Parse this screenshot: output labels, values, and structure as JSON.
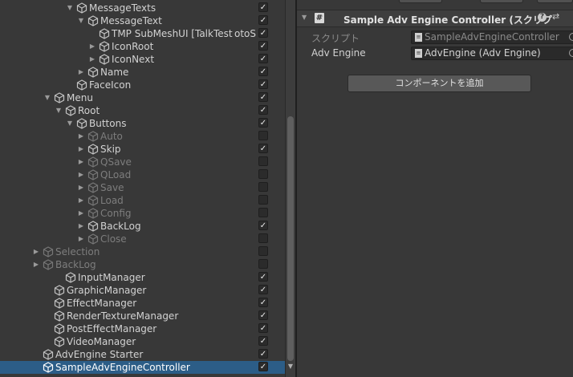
{
  "hierarchy": {
    "rows": [
      {
        "label": "MessageTexts",
        "arrow": "down",
        "checked": true
      },
      {
        "label": "MessageText",
        "arrow": "down",
        "checked": true
      },
      {
        "label": "TMP SubMeshUI [TalkTest otoS",
        "arrow": "",
        "checked": true
      },
      {
        "label": "IconRoot",
        "arrow": "right",
        "checked": true
      },
      {
        "label": "IconNext",
        "arrow": "right",
        "checked": true
      },
      {
        "label": "Name",
        "arrow": "right",
        "checked": true
      },
      {
        "label": "FaceIcon",
        "arrow": "",
        "checked": true
      },
      {
        "label": "Menu",
        "arrow": "down",
        "checked": true
      },
      {
        "label": "Root",
        "arrow": "down",
        "checked": true
      },
      {
        "label": "Buttons",
        "arrow": "down",
        "checked": true
      },
      {
        "label": "Auto",
        "arrow": "right",
        "checked": false,
        "dim": true
      },
      {
        "label": "Skip",
        "arrow": "right",
        "checked": true
      },
      {
        "label": "QSave",
        "arrow": "right",
        "checked": false,
        "dim": true
      },
      {
        "label": "QLoad",
        "arrow": "right",
        "checked": false,
        "dim": true
      },
      {
        "label": "Save",
        "arrow": "right",
        "checked": false,
        "dim": true
      },
      {
        "label": "Load",
        "arrow": "right",
        "checked": false,
        "dim": true
      },
      {
        "label": "Config",
        "arrow": "right",
        "checked": false,
        "dim": true
      },
      {
        "label": "BackLog",
        "arrow": "right",
        "checked": true
      },
      {
        "label": "Close",
        "arrow": "right",
        "checked": false,
        "dim": true
      },
      {
        "label": "Selection",
        "arrow": "right",
        "checked": false,
        "dim": true
      },
      {
        "label": "BackLog",
        "arrow": "right",
        "checked": false,
        "dim": true
      },
      {
        "label": "InputManager",
        "arrow": "",
        "checked": true
      },
      {
        "label": "GraphicManager",
        "arrow": "",
        "checked": true
      },
      {
        "label": "EffectManager",
        "arrow": "",
        "checked": true
      },
      {
        "label": "RenderTextureManager",
        "arrow": "",
        "checked": true
      },
      {
        "label": "PostEffectManager",
        "arrow": "",
        "checked": true
      },
      {
        "label": "VideoManager",
        "arrow": "",
        "checked": true
      },
      {
        "label": "AdvEngine Starter",
        "arrow": "",
        "checked": true
      },
      {
        "label": "SampleAdvEngineController",
        "arrow": "",
        "checked": true,
        "selected": true
      }
    ]
  },
  "inspector": {
    "component": {
      "title": "Sample Adv Engine Controller (スクリプ",
      "icon": "script-hash-icon"
    },
    "script_label": "スクリプト",
    "script_value": "SampleAdvEngineController",
    "engine_label": "Adv Engine",
    "engine_value": "AdvEngine (Adv Engine)",
    "add_component": "コンポーネントを追加"
  },
  "colors": {
    "background": "#383838",
    "selection": "#2c5d87"
  }
}
